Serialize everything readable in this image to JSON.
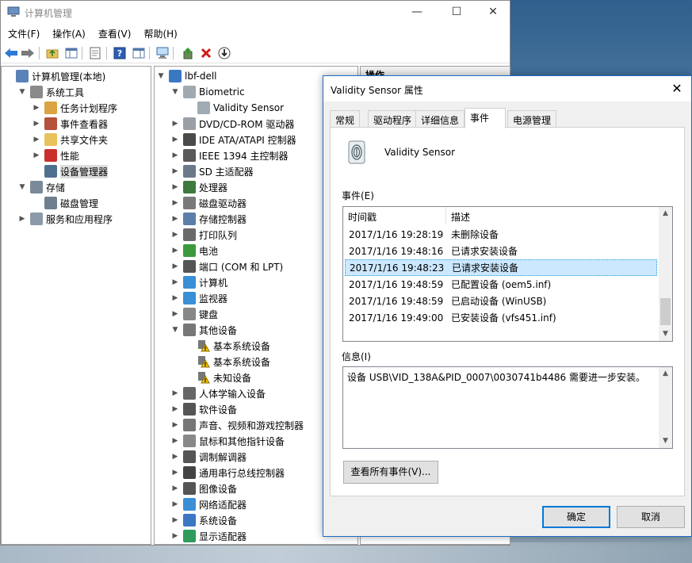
{
  "main_window": {
    "title": "计算机管理",
    "menu": [
      "文件(F)",
      "操作(A)",
      "查看(V)",
      "帮助(H)"
    ],
    "left_tree": [
      {
        "label": "计算机管理(本地)",
        "depth": 0,
        "arrow": "",
        "icon": "computer-management-icon"
      },
      {
        "label": "系统工具",
        "depth": 1,
        "arrow": "expanded",
        "icon": "tools-icon"
      },
      {
        "label": "任务计划程序",
        "depth": 2,
        "arrow": "collapsed",
        "icon": "clock-icon"
      },
      {
        "label": "事件查看器",
        "depth": 2,
        "arrow": "collapsed",
        "icon": "event-viewer-icon"
      },
      {
        "label": "共享文件夹",
        "depth": 2,
        "arrow": "collapsed",
        "icon": "shared-folder-icon"
      },
      {
        "label": "性能",
        "depth": 2,
        "arrow": "collapsed",
        "icon": "performance-icon"
      },
      {
        "label": "设备管理器",
        "depth": 2,
        "arrow": "",
        "icon": "device-manager-icon",
        "selected": true
      },
      {
        "label": "存储",
        "depth": 1,
        "arrow": "expanded",
        "icon": "storage-icon"
      },
      {
        "label": "磁盘管理",
        "depth": 2,
        "arrow": "",
        "icon": "disk-icon"
      },
      {
        "label": "服务和应用程序",
        "depth": 1,
        "arrow": "collapsed",
        "icon": "services-icon"
      }
    ],
    "device_tree": [
      {
        "label": "lbf-dell",
        "depth": 0,
        "arrow": "expanded",
        "icon": "computer-icon"
      },
      {
        "label": "Biometric",
        "depth": 1,
        "arrow": "expanded",
        "icon": "fingerprint-icon"
      },
      {
        "label": "Validity Sensor",
        "depth": 2,
        "arrow": "",
        "icon": "fingerprint-icon"
      },
      {
        "label": "DVD/CD-ROM 驱动器",
        "depth": 1,
        "arrow": "collapsed",
        "icon": "dvd-icon"
      },
      {
        "label": "IDE ATA/ATAPI 控制器",
        "depth": 1,
        "arrow": "collapsed",
        "icon": "ide-icon"
      },
      {
        "label": "IEEE 1394 主控制器",
        "depth": 1,
        "arrow": "collapsed",
        "icon": "ieee1394-icon"
      },
      {
        "label": "SD 主适配器",
        "depth": 1,
        "arrow": "collapsed",
        "icon": "sd-icon"
      },
      {
        "label": "处理器",
        "depth": 1,
        "arrow": "collapsed",
        "icon": "cpu-icon"
      },
      {
        "label": "磁盘驱动器",
        "depth": 1,
        "arrow": "collapsed",
        "icon": "disk-drive-icon"
      },
      {
        "label": "存储控制器",
        "depth": 1,
        "arrow": "collapsed",
        "icon": "storage-controller-icon"
      },
      {
        "label": "打印队列",
        "depth": 1,
        "arrow": "collapsed",
        "icon": "printer-icon"
      },
      {
        "label": "电池",
        "depth": 1,
        "arrow": "collapsed",
        "icon": "battery-icon"
      },
      {
        "label": "端口 (COM 和 LPT)",
        "depth": 1,
        "arrow": "collapsed",
        "icon": "port-icon"
      },
      {
        "label": "计算机",
        "depth": 1,
        "arrow": "collapsed",
        "icon": "monitor-icon"
      },
      {
        "label": "监视器",
        "depth": 1,
        "arrow": "collapsed",
        "icon": "monitor-icon"
      },
      {
        "label": "键盘",
        "depth": 1,
        "arrow": "collapsed",
        "icon": "keyboard-icon"
      },
      {
        "label": "其他设备",
        "depth": 1,
        "arrow": "expanded",
        "icon": "unknown-device-icon"
      },
      {
        "label": "基本系统设备",
        "depth": 2,
        "arrow": "",
        "icon": "warning-device-icon"
      },
      {
        "label": "基本系统设备",
        "depth": 2,
        "arrow": "",
        "icon": "warning-device-icon"
      },
      {
        "label": "未知设备",
        "depth": 2,
        "arrow": "",
        "icon": "warning-device-icon"
      },
      {
        "label": "人体学输入设备",
        "depth": 1,
        "arrow": "collapsed",
        "icon": "hid-icon"
      },
      {
        "label": "软件设备",
        "depth": 1,
        "arrow": "collapsed",
        "icon": "software-device-icon"
      },
      {
        "label": "声音、视频和游戏控制器",
        "depth": 1,
        "arrow": "collapsed",
        "icon": "sound-icon"
      },
      {
        "label": "鼠标和其他指针设备",
        "depth": 1,
        "arrow": "collapsed",
        "icon": "mouse-icon"
      },
      {
        "label": "调制解调器",
        "depth": 1,
        "arrow": "collapsed",
        "icon": "modem-icon"
      },
      {
        "label": "通用串行总线控制器",
        "depth": 1,
        "arrow": "collapsed",
        "icon": "usb-icon"
      },
      {
        "label": "图像设备",
        "depth": 1,
        "arrow": "collapsed",
        "icon": "camera-icon"
      },
      {
        "label": "网络适配器",
        "depth": 1,
        "arrow": "collapsed",
        "icon": "network-icon"
      },
      {
        "label": "系统设备",
        "depth": 1,
        "arrow": "collapsed",
        "icon": "system-device-icon"
      },
      {
        "label": "显示适配器",
        "depth": 1,
        "arrow": "collapsed",
        "icon": "display-adapter-icon"
      }
    ],
    "actions_header": "操作"
  },
  "dialog": {
    "title": "Validity Sensor 属性",
    "tabs": [
      {
        "label": "常规",
        "active": false
      },
      {
        "label": "驱动程序",
        "active": false
      },
      {
        "label": "详细信息",
        "active": false
      },
      {
        "label": "事件",
        "active": true
      },
      {
        "label": "电源管理",
        "active": false
      }
    ],
    "device_name": "Validity Sensor",
    "events_label": "事件(E)",
    "events_columns": [
      "时间戳",
      "描述"
    ],
    "events": [
      {
        "time": "2017/1/16 19:28:19",
        "desc": "未删除设备",
        "selected": false
      },
      {
        "time": "2017/1/16 19:48:16",
        "desc": "已请求安装设备",
        "selected": false
      },
      {
        "time": "2017/1/16 19:48:23",
        "desc": "已请求安装设备",
        "selected": true
      },
      {
        "time": "2017/1/16 19:48:59",
        "desc": "已配置设备 (oem5.inf)",
        "selected": false
      },
      {
        "time": "2017/1/16 19:48:59",
        "desc": "已启动设备 (WinUSB)",
        "selected": false
      },
      {
        "time": "2017/1/16 19:49:00",
        "desc": "已安装设备 (vfs451.inf)",
        "selected": false
      }
    ],
    "info_label": "信息(I)",
    "info_text": "设备 USB\\VID_138A&PID_0007\\0030741b4486 需要进一步安装。",
    "view_all_button": "查看所有事件(V)...",
    "ok_button": "确定",
    "cancel_button": "取消"
  }
}
